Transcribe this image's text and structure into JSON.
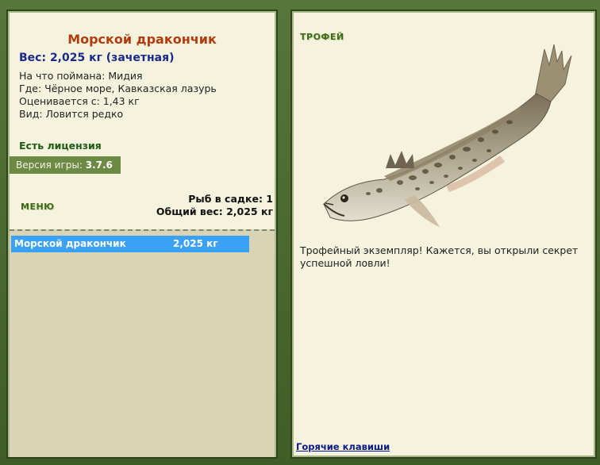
{
  "catch": {
    "fish_name": "Морской дракончик",
    "weight_line": "Вес: 2,025 кг (зачетная)",
    "bait": "На что поймана: Мидия",
    "location": "Где: Чёрное море, Кавказская лазурь",
    "value": "Оценивается с: 1,43 кг",
    "rarity": "Вид: Ловится редко"
  },
  "license_status": "Есть лицензия",
  "version": {
    "label": "Версия игры:",
    "number": "3.7.6"
  },
  "menu": {
    "label": "МЕНЮ"
  },
  "keepnet": {
    "fish_count": "Рыб в садке: 1",
    "total_weight": "Общий вес: 2,025 кг"
  },
  "catch_list": [
    {
      "name": "Морской дракончик",
      "weight": "2,025 кг"
    }
  ],
  "trophy": {
    "title": "ТРОФЕЙ",
    "message": "Трофейный экземпляр! Кажется, вы открыли секрет успешной ловли!"
  },
  "hotkeys_link": "Горячие клавиши",
  "colors": {
    "frame": "#4a6a2c",
    "panel": "#f5f2de",
    "fish_name": "#b23c0c",
    "weight": "#1a2a8a",
    "list_selected": "#3aa1f7"
  },
  "icons": {
    "trophy_image": "weever-fish-illustration"
  }
}
